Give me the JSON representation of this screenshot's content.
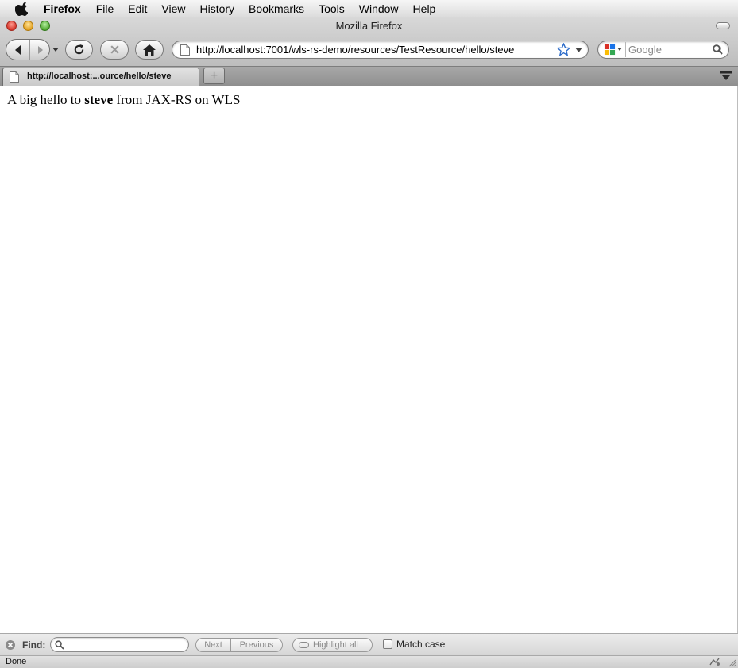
{
  "menubar": {
    "app": "Firefox",
    "items": [
      "File",
      "Edit",
      "View",
      "History",
      "Bookmarks",
      "Tools",
      "Window",
      "Help"
    ]
  },
  "window": {
    "title": "Mozilla Firefox"
  },
  "toolbar": {
    "url": "http://localhost:7001/wls-rs-demo/resources/TestResource/hello/steve",
    "search_placeholder": "Google"
  },
  "tabs": [
    {
      "label": "http://localhost:...ource/hello/steve"
    }
  ],
  "newtab_label": "+",
  "content": {
    "prefix": "A big hello to ",
    "name": "steve",
    "suffix": " from JAX-RS on WLS"
  },
  "findbar": {
    "label": "Find:",
    "next": "Next",
    "previous": "Previous",
    "highlight": "Highlight all",
    "match_case": "Match case"
  },
  "status": {
    "text": "Done"
  }
}
